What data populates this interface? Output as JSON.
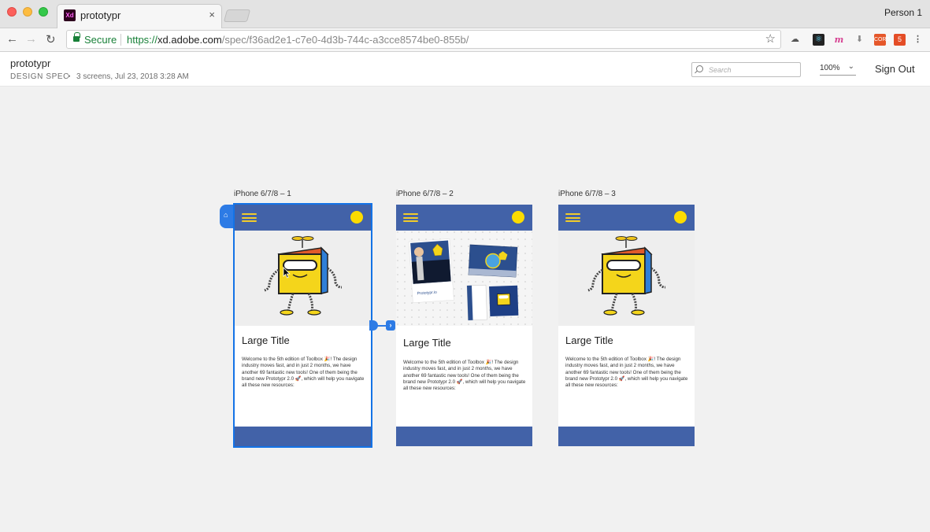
{
  "browser": {
    "tab_title": "prototypr",
    "tab_close": "×",
    "tab_favicon": "Xd",
    "profile": "Person 1",
    "secure_label": "Secure",
    "url_scheme": "https://",
    "url_host": "xd.adobe.com",
    "url_path": "/spec/f36ad2e1-c7e0-4d3b-744c-a3cce8574be0-855b/",
    "icons": [
      "back-arrow-icon",
      "forward-arrow-icon",
      "reload-icon",
      "lock-icon",
      "star-icon",
      "cloud-icon",
      "react-devtools-icon",
      "m-extension-icon",
      "download-icon",
      "cors-extension-icon",
      "html5-extension-icon",
      "menu-dots-icon"
    ],
    "ext_cors": "CORS",
    "ext_html": "5"
  },
  "header": {
    "project_name": "prototypr",
    "spec_label": "DESIGN SPEC",
    "meta_separator": "•",
    "meta": "3 screens, Jul 23, 2018 3:28 AM",
    "search_placeholder": "Search",
    "zoom": "100%",
    "sign_out": "Sign Out"
  },
  "artboards": [
    {
      "label": "iPhone 6/7/8 – 1",
      "title": "Large Title",
      "body": "Welcome to the 5th edition of Toolbox 🎉! The design industry moves fast, and in just 2 months, we have another 69 fantastic new tools! One of them being the brand new Prototypr 2.0 🚀, which will help you navigate all these new resources:",
      "hero": "robot-illustration",
      "selected": true
    },
    {
      "label": "iPhone 6/7/8 – 2",
      "title": "Large Title",
      "body": "Welcome to the 5th edition of Toolbox 🎉! The design industry moves fast, and in just 2 months, we have another 69 fantastic new tools! One of them being the brand new Prototypr 2.0 🚀, which will help you navigate all these new resources:",
      "hero": "cards-illustration",
      "hero_card_text": "Prototypr.io",
      "selected": false
    },
    {
      "label": "iPhone 6/7/8 – 3",
      "title": "Large Title",
      "body": "Welcome to the 5th edition of Toolbox 🎉! The design industry moves fast, and in just 2 months, we have another 69 fantastic new tools! One of them being the brand new Prototypr 2.0 🚀, which will help you navigate all these new resources:",
      "hero": "robot-illustration",
      "selected": false
    }
  ],
  "colors": {
    "artboard_header": "#4262a8",
    "hamburger": "#f1cb2a",
    "avatar": "#fcdc00",
    "selection": "#1473e6",
    "link": "#2d7be5",
    "canvas": "#f1f1f1"
  }
}
